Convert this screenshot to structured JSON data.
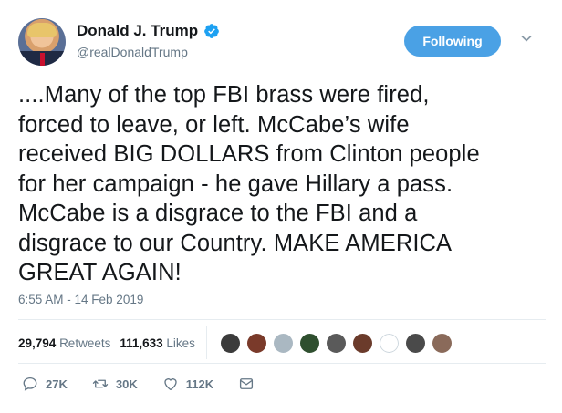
{
  "author": {
    "display_name": "Donald J. Trump",
    "handle": "@realDonaldTrump",
    "verified": true
  },
  "follow_button": {
    "label": "Following"
  },
  "tweet": {
    "lines": [
      "....Many of the top FBI brass were fired,",
      "forced to leave, or left. McCabe’s wife",
      "received BIG DOLLARS from Clinton people",
      "for her campaign - he gave Hillary a pass.",
      "McCabe is a disgrace to the FBI and a",
      "disgrace to our Country. MAKE AMERICA",
      "GREAT AGAIN!"
    ],
    "timestamp": "6:55 AM - 14 Feb 2019"
  },
  "stats": {
    "retweets_count": "29,794",
    "retweets_label": "Retweets",
    "likes_count": "111,633",
    "likes_label": "Likes"
  },
  "liker_avatars": [
    "#3b3b3b",
    "#7a3a2a",
    "#aab8c2",
    "#2f4f2f",
    "#5a5a5a",
    "#6b3b2b",
    "#ffffff",
    "#4a4a4a",
    "#8a6a5a"
  ],
  "actions": {
    "reply_count": "27K",
    "retweet_count": "30K",
    "like_count": "112K"
  },
  "colors": {
    "accent": "#4aa1e5",
    "verified": "#1da1f2",
    "muted": "#657786"
  },
  "icons": [
    "verified-badge-icon",
    "chevron-down-icon",
    "reply-icon",
    "retweet-icon",
    "like-icon",
    "message-icon"
  ]
}
